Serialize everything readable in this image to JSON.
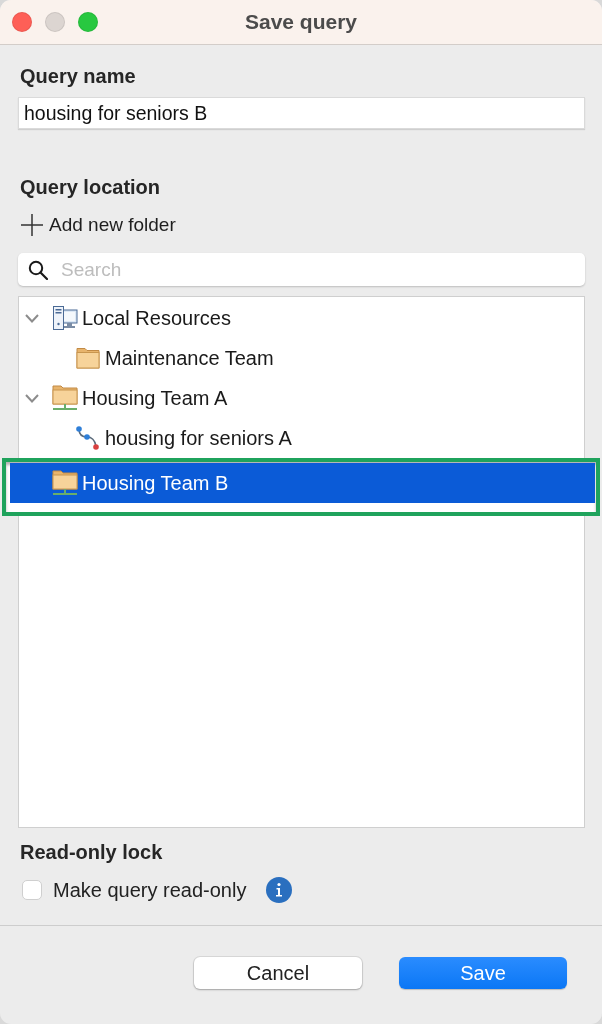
{
  "window": {
    "title": "Save query",
    "controls": [
      {
        "kind": "close",
        "disabled": false
      },
      {
        "kind": "minimize",
        "disabled": true
      },
      {
        "kind": "zoom",
        "disabled": false
      }
    ]
  },
  "query_name": {
    "label": "Query name",
    "value": "housing for seniors B"
  },
  "query_location": {
    "label": "Query location",
    "add_folder_button": "Add new folder",
    "search": {
      "placeholder": "Search"
    },
    "tree": [
      {
        "label": "Local Resources",
        "kind": "computer",
        "expanded": true,
        "selected": false,
        "highlighted": false,
        "children": [
          {
            "label": "Maintenance Team",
            "kind": "folder",
            "selected": false,
            "highlighted": false
          }
        ]
      },
      {
        "label": "Housing Team A",
        "kind": "shared_folder",
        "expanded": true,
        "selected": false,
        "highlighted": false,
        "children": [
          {
            "label": "housing for seniors A",
            "kind": "query",
            "selected": false,
            "highlighted": false
          }
        ]
      },
      {
        "label": "Housing Team B",
        "kind": "shared_folder",
        "selected": true,
        "highlighted": true
      }
    ]
  },
  "read_only_lock": {
    "label": "Read-only lock",
    "checkbox": {
      "label": "Make query read-only",
      "checked": false
    }
  },
  "buttons": [
    {
      "label": "Cancel",
      "kind": "secondary"
    },
    {
      "label": "Save",
      "kind": "primary"
    }
  ]
}
